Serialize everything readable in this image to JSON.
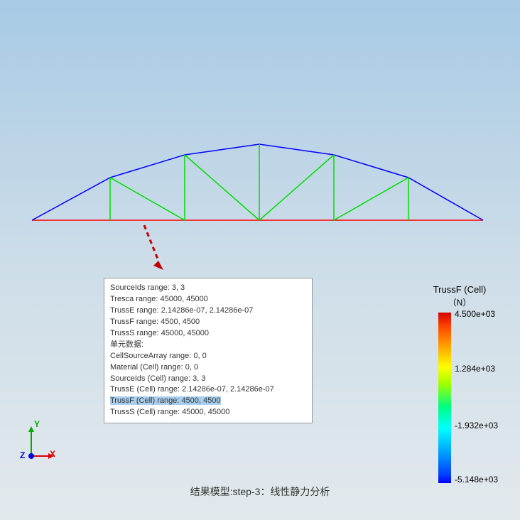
{
  "info_panel": {
    "lines": [
      "SourceIds range: 3, 3",
      "Tresca range: 45000, 45000",
      "TrussE range: 2.14286e-07, 2.14286e-07",
      "TrussF range: 4500, 4500",
      "TrussS range: 45000, 45000",
      "单元数据:",
      "CellSourceArray range: 0, 0",
      "Material (Cell) range: 0, 0",
      "SourceIds (Cell) range: 3, 3",
      "TrussE (Cell) range: 2.14286e-07, 2.14286e-07"
    ],
    "highlighted": "TrussF (Cell) range: 4500, 4500",
    "after_highlight": "TrussS (Cell) range: 45000, 45000"
  },
  "scalar_bar": {
    "title": "TrussF (Cell)",
    "unit": "（N）",
    "labels": {
      "top": "4.500e+03",
      "upper_mid": "1.284e+03",
      "lower_mid": "-1.932e+03",
      "bottom": "-5.148e+03"
    }
  },
  "axis": {
    "y": "Y",
    "x": "X",
    "z": "Z"
  },
  "caption": "结果模型:step-3：线性静力分析"
}
